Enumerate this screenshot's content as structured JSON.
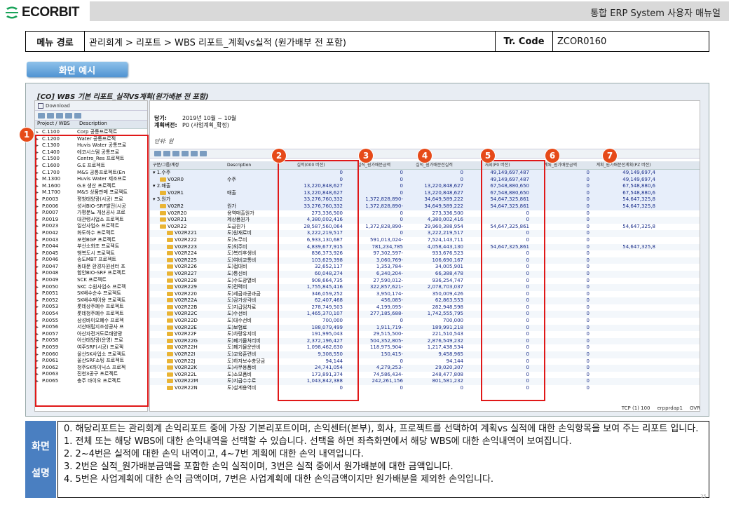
{
  "header": {
    "logo_text": "ECORBIT",
    "doc_title": "통합 ERP System 사용자 매뉴얼"
  },
  "menu": {
    "label": "메뉴 경로",
    "path": "관리회계 > 리포트 > WBS 리포트_계획vs실적 (원가배부 전 포함)",
    "tr_label": "Tr. Code",
    "tr_code": "ZCOR0160"
  },
  "example_button": "화면 예시",
  "screen": {
    "title": "[CO] WBS 기본 리포트_실적VS계획(원가배분 전 포함)",
    "download": "Download",
    "left_headers": [
      "Project / WBS",
      "Description"
    ],
    "projects": [
      [
        "C.1100",
        "Corp 공통프로젝트"
      ],
      [
        "C.1200",
        "Water 공통프로젝"
      ],
      [
        "C.1300",
        "Huvis Water 공통프로"
      ],
      [
        "C.1400",
        "에코시스템 공통프로"
      ],
      [
        "C.1500",
        "Centro_Res 프로젝트"
      ],
      [
        "C.1600",
        "G.E 프로젝트"
      ],
      [
        "C.1700",
        "M&S 공통프로젝트(En"
      ],
      [
        "M.1300",
        "Huvis Water 제조프로"
      ],
      [
        "M.1600",
        "G.E 생산 프로젝트"
      ],
      [
        "M.1700",
        "M&S 상품판매 프로젝트"
      ],
      [
        "P.0003",
        "평창태양광(시공) 프로"
      ],
      [
        "P.0006",
        "성서BIO-SRF발전(시공"
      ],
      [
        "P.0007",
        "가평분뇨 개선공사 프로"
      ],
      [
        "P.0019",
        "대관령사업소 프로젝트"
      ],
      [
        "P.0023",
        "일산사업소 프로젝트"
      ],
      [
        "P.0042",
        "화도하수 프로젝트"
      ],
      [
        "P.0043",
        "포천BGP 프로젝트"
      ],
      [
        "P.0044",
        "부산소화조 프로젝트"
      ],
      [
        "P.0045",
        "행복도시 프로젝트"
      ],
      [
        "P.0046",
        "송도MBT 프로젝트"
      ],
      [
        "P.0047",
        "동대문 환경자원센터 프"
      ],
      [
        "P.0048",
        "함안BIO-SRF 프로젝트"
      ],
      [
        "P.0049",
        "SCK 프로젝트"
      ],
      [
        "P.0050",
        "SKC 수원사업소 프로젝"
      ],
      [
        "P.0051",
        "SK배수순수 프로젝트"
      ],
      [
        "P.0052",
        "SK배수재이용 프로젝트"
      ],
      [
        "P.0053",
        "롯데상주폐수 프로젝트"
      ],
      [
        "P.0054",
        "롯데청주폐수 프로젝트"
      ],
      [
        "P.0055",
        "삼성바이오폐수 프로젝"
      ],
      [
        "P.0056",
        "서산매립지조성공사 프"
      ],
      [
        "P.0057",
        "아산자전거도로태양광"
      ],
      [
        "P.0058",
        "아산태양광(운영) 프로"
      ],
      [
        "P.0059",
        "여주SRF(시공) 프로젝"
      ],
      [
        "P.0060",
        "울산SK사업소 프로젝트"
      ],
      [
        "P.0061",
        "울산SRF소팅 프로젝트"
      ],
      [
        "P.0062",
        "청주SK하이닉스 프로젝"
      ],
      [
        "P.0063",
        "진천3공구 프로젝트"
      ],
      [
        "P.0065",
        "충주 바이오 프로젝트"
      ]
    ],
    "info": {
      "period_label": "당기:",
      "period": "2019년 10월 ~ 10월",
      "version_label": "계획버전:",
      "version": "P0 (사업계획_확정)",
      "unit": "단위: 원"
    },
    "grid_headers": [
      "구분/그룹/계정",
      "Description",
      "실적(000 버전)",
      "실적_원가배분금액",
      "실적_원가배분전실적",
      "계획(P0 버전)",
      "계획_원가배분금액",
      "계획_원가배분전계획(PZ 버전)"
    ],
    "rows": [
      [
        "▾ 1.수주",
        "",
        "0",
        "0",
        "0",
        "49,149,697,487",
        "0",
        "49,149,697,4"
      ],
      [
        "V02R0",
        "수주",
        "0",
        "0",
        "0",
        "49,149,697,487",
        "0",
        "49,149,697,4"
      ],
      [
        "▾ 2.매출",
        "",
        "13,220,848,627",
        "0",
        "13,220,848,627",
        "67,548,880,650",
        "0",
        "67,548,880,6"
      ],
      [
        "V02R1",
        "매출",
        "13,220,848,627",
        "0",
        "13,220,848,627",
        "67,548,880,650",
        "0",
        "67,548,880,6"
      ],
      [
        "▾ 3.원가",
        "",
        "33,276,760,332",
        "1,372,828,890-",
        "34,649,589,222",
        "54,647,325,861",
        "0",
        "54,647,325,8"
      ],
      [
        "V02R2",
        "원가",
        "33,276,760,332",
        "1,372,828,890-",
        "34,649,589,222",
        "54,647,325,861",
        "0",
        "54,647,325,8"
      ],
      [
        "V02R20",
        "용역매출원가",
        "273,336,500",
        "0",
        "273,336,500",
        "0",
        "0",
        ""
      ],
      [
        "V02R21",
        "제상품원가",
        "4,380,002,416",
        "0",
        "4,380,002,416",
        "0",
        "0",
        ""
      ],
      [
        "V02R22",
        "도급원가",
        "28,587,560,064",
        "1,372,828,890-",
        "29,960,388,954",
        "54,647,325,861",
        "0",
        "54,647,325,8"
      ],
      [
        "V02R221",
        "도)원재료비",
        "3,222,219,517",
        "0",
        "3,222,219,517",
        "0",
        "0",
        ""
      ],
      [
        "V02R222",
        "도)노무비",
        "6,933,130,687",
        "591,013,024-",
        "7,524,143,711",
        "0",
        "0",
        ""
      ],
      [
        "V02R223",
        "도)외주비",
        "4,839,677,915",
        "781,234,785",
        "4,058,443,130",
        "54,647,325,861",
        "0",
        "54,647,325,8"
      ],
      [
        "V02R224",
        "도)복리후생비",
        "836,373,926",
        "97,302,597-",
        "933,676,523",
        "0",
        "0",
        ""
      ],
      [
        "V02R225",
        "도)여비교통비",
        "103,629,398",
        "3,060,769-",
        "106,690,167",
        "0",
        "0",
        ""
      ],
      [
        "V02R226",
        "도)접대비",
        "32,652,117",
        "1,353,784-",
        "34,005,901",
        "0",
        "0",
        ""
      ],
      [
        "V02R227",
        "도)통신비",
        "60,048,274",
        "6,340,204-",
        "66,388,478",
        "0",
        "0",
        ""
      ],
      [
        "V02R228",
        "도)수도광열비",
        "908,664,735",
        "27,590,012-",
        "936,254,747",
        "0",
        "0",
        ""
      ],
      [
        "V02R229",
        "도)전력비",
        "1,755,845,416",
        "322,857,621-",
        "2,078,703,037",
        "0",
        "0",
        ""
      ],
      [
        "V02R220",
        "도)세금과공과금",
        "346,059,252",
        "3,950,174-",
        "350,009,426",
        "0",
        "0",
        ""
      ],
      [
        "V02R22A",
        "도)감가상각비",
        "62,407,468",
        "456,085-",
        "62,863,553",
        "0",
        "0",
        ""
      ],
      [
        "V02R22B",
        "도)지급임차료",
        "278,749,503",
        "4,199,095-",
        "282,948,598",
        "0",
        "0",
        ""
      ],
      [
        "V02R22C",
        "도)수선비",
        "1,465,370,107",
        "277,185,688-",
        "1,742,555,795",
        "0",
        "0",
        ""
      ],
      [
        "V02R22D",
        "도)대수선비",
        "700,000",
        "0",
        "700,000",
        "0",
        "0",
        ""
      ],
      [
        "V02R22E",
        "도)보험료",
        "188,079,499",
        "1,911,719-",
        "189,991,218",
        "0",
        "0",
        ""
      ],
      [
        "V02R22F",
        "도)차량유지비",
        "191,995,043",
        "29,515,500-",
        "221,510,543",
        "0",
        "0",
        ""
      ],
      [
        "V02R22G",
        "도)폐기물처리비",
        "2,372,196,427",
        "504,352,805-",
        "2,876,549,232",
        "0",
        "0",
        ""
      ],
      [
        "V02R22H",
        "도)폐기물운반비",
        "1,098,462,630",
        "118,975,904-",
        "1,217,438,534",
        "0",
        "0",
        ""
      ],
      [
        "V02R22I",
        "도)교육훈련비",
        "9,308,550",
        "150,415-",
        "9,458,965",
        "0",
        "0",
        ""
      ],
      [
        "V02R22J",
        "도)하자보수충당금",
        "94,144",
        "0",
        "94,144",
        "0",
        "0",
        ""
      ],
      [
        "V02R22K",
        "도)사무용품비",
        "24,741,054",
        "4,279,253-",
        "29,020,307",
        "0",
        "0",
        ""
      ],
      [
        "V02R22L",
        "도)소모품비",
        "173,891,374",
        "74,586,434-",
        "248,477,808",
        "0",
        "0",
        ""
      ],
      [
        "V02R22M",
        "도)지급수수료",
        "1,043,842,388",
        "242,261,156",
        "801,581,232",
        "0",
        "0",
        ""
      ],
      [
        "V02R22N",
        "도)설계용역비",
        "0",
        "0",
        "0",
        "0",
        "0",
        ""
      ]
    ],
    "status": [
      "TCP (1) 100",
      "erpprdap1",
      "OVR"
    ]
  },
  "badges": [
    "1",
    "2",
    "3",
    "4",
    "5",
    "6",
    "7"
  ],
  "description": {
    "label_top": "화면",
    "label_bottom": "설명",
    "lines": [
      "0. 해당리포트는 관리회계 손익리포트 중에 가장 기본리포트이며, 손익센터(본부), 회사, 프로젝트를 선택하여 계획vs 실적에 대한 손익항목을 보여 주는 리포트 입니다.",
      "1. 전체 또는 해당 WBS에 대한 손익내역을 선택할 수 있습니다. 선택을 하면 좌측화면에서 해당 WBS에 대한 손익내역이 보여집니다.",
      "2. 2~4번은 실적에 대한 손익 내역이고, 4~7번 계획에 대한 손익 내역입니다.",
      "3. 2번은 실적_원가배분금액을 포함한 손익 실적이며, 3번은 실적 중에서 원가배분에 대한 금액입니다.",
      "4. 5번은 사업계획에 대한 손익 금액이며, 7번은 사업계획에 대한 손익금액이지만 원가배분을 제외한 손익입니다."
    ]
  },
  "page_number": "25",
  "colors": {
    "badge": "#e64a19",
    "highlight_box": "#e01818",
    "label_bg": "#4a7fc1"
  }
}
